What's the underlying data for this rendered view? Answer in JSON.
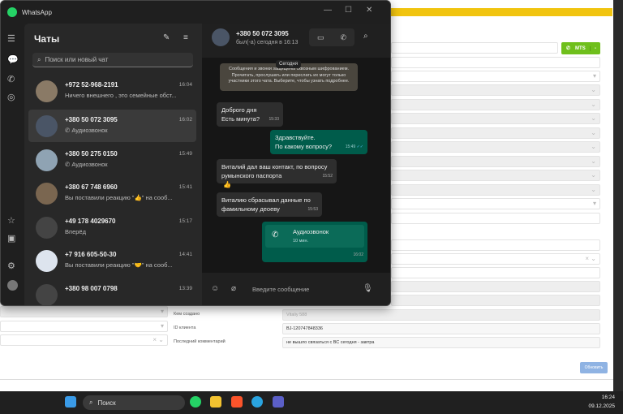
{
  "crm": {
    "labels": [
      "Кем создано",
      "ID клиента",
      "Последний комментарий"
    ],
    "values": [
      "Vitaliy 588",
      "BJ-120747848336",
      "не вышло связаться с ВС сегодня - завтра"
    ],
    "mts_label": "MTS",
    "mts_dropdown": "-",
    "update_button": "Обновить",
    "accent": "#f1c40f"
  },
  "whatsapp": {
    "title": "WhatsApp",
    "chats_heading": "Чаты",
    "search_placeholder": "Поиск или новый чат",
    "chats": [
      {
        "name": "+972 52-968-2191",
        "time": "16:04",
        "preview": "Ничего внешнего , это семейные обст..."
      },
      {
        "name": "+380 50 072 3095",
        "time": "16:02",
        "preview": "Аудиозвонок",
        "selected": true
      },
      {
        "name": "+380 50 275 0150",
        "time": "15:49",
        "preview": "Аудиозвонок"
      },
      {
        "name": "+380 67 748 6960",
        "time": "15:41",
        "preview": "Вы поставили реакцию \"👍\" на сооб..."
      },
      {
        "name": "+49 178 4029670",
        "time": "15:17",
        "preview": "Вперёд"
      },
      {
        "name": "+7 916 605-50-30",
        "time": "14:41",
        "preview": "Вы поставили реакцию \"🤝\" на сооб..."
      },
      {
        "name": "+380 98 007 0798",
        "time": "13:39",
        "preview": ""
      }
    ],
    "contact": {
      "name": "+380 50 072 3095",
      "status": "был(-а) сегодня в 16:13"
    },
    "date_chip": "Сегодня",
    "encryption_notice": "Сообщения и звонки защищены сквозным шифрованием. Прочитать, прослушать или переслать их могут только участники этого чата. Выберите, чтобы узнать подробнее.",
    "messages": [
      {
        "text": "Доброго дня\nЕсть минута?",
        "time": "15:33",
        "dir": "in"
      },
      {
        "text": "Здравствуйте.\nПо какому вопросу?",
        "time": "15:49",
        "dir": "out"
      },
      {
        "text": "Виталий дал ваш контакт, по вопросу румынского паспорта",
        "time": "15:52",
        "dir": "in",
        "reaction": "👍"
      },
      {
        "text": "Виталию сбрасывал данные по фамильному деоеву",
        "time": "15:53",
        "dir": "in"
      }
    ],
    "call": {
      "label": "Аудиозвонок",
      "duration": "10 мин.",
      "time": "16:02"
    },
    "compose_placeholder": "Введите сообщение",
    "outgoing_color": "#005c4b"
  },
  "taskbar": {
    "search": "Поиск",
    "time": "16:24",
    "date": "09.12.2025"
  }
}
